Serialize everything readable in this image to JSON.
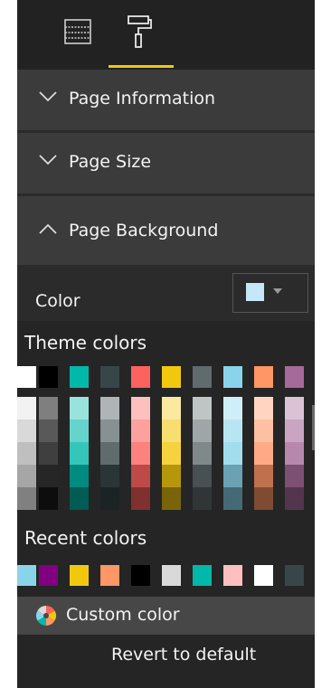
{
  "tabs": [
    {
      "icon": "fields-grid-icon"
    },
    {
      "icon": "paint-roller-icon",
      "active": true
    }
  ],
  "accent": "#f2c80f",
  "sections": {
    "page_information": "Page Information",
    "page_size": "Page Size",
    "page_background": "Page Background"
  },
  "color": {
    "label": "Color",
    "selected": "#c4e8f7"
  },
  "dropdown": {
    "theme_label": "Theme colors",
    "recent_label": "Recent colors",
    "custom_label": "Custom color",
    "revert_label": "Revert to default",
    "theme_colors": [
      {
        "base": "#ffffff",
        "shades": [
          "#f2f2f2",
          "#d9d9d9",
          "#bfbfbf",
          "#a6a6a6",
          "#808080"
        ]
      },
      {
        "base": "#000000",
        "shades": [
          "#7f7f7f",
          "#595959",
          "#3f3f3f",
          "#262626",
          "#0d0d0d"
        ]
      },
      {
        "base": "#01b8aa",
        "shades": [
          "#99e3dd",
          "#66d4cc",
          "#34c6bb",
          "#018a80",
          "#005c55"
        ]
      },
      {
        "base": "#374649",
        "shades": [
          "#afb5b6",
          "#879092",
          "#5f6b6d",
          "#293537",
          "#1c2325"
        ]
      },
      {
        "base": "#fd625e",
        "shades": [
          "#fec0bf",
          "#fea19e",
          "#fd817e",
          "#be4a47",
          "#7f312f"
        ]
      },
      {
        "base": "#f2c80f",
        "shades": [
          "#fae99f",
          "#f7de6f",
          "#f5d33f",
          "#b6960b",
          "#796408"
        ]
      },
      {
        "base": "#5f6b6d",
        "shades": [
          "#bfc4c5",
          "#9fa6a7",
          "#7f898a",
          "#475052",
          "#303637"
        ]
      },
      {
        "base": "#8ad4eb",
        "shades": [
          "#d0eef7",
          "#b9e5f3",
          "#a1ddef",
          "#6aa2b3",
          "#456a75"
        ]
      },
      {
        "base": "#fe9666",
        "shades": [
          "#ffd5c2",
          "#fec0a3",
          "#feab85",
          "#bf714d",
          "#7f4b33"
        ]
      },
      {
        "base": "#a66999",
        "shades": [
          "#dbc3d6",
          "#caa5c2",
          "#b887ad",
          "#7d4f73",
          "#53354d"
        ]
      }
    ],
    "recent_colors": [
      "#8ad4eb",
      "#800080",
      "#f2c80f",
      "#fe9666",
      "#000000",
      "#d9d9d9",
      "#01b8aa",
      "#fec0bf",
      "#ffffff",
      "#374649"
    ]
  }
}
